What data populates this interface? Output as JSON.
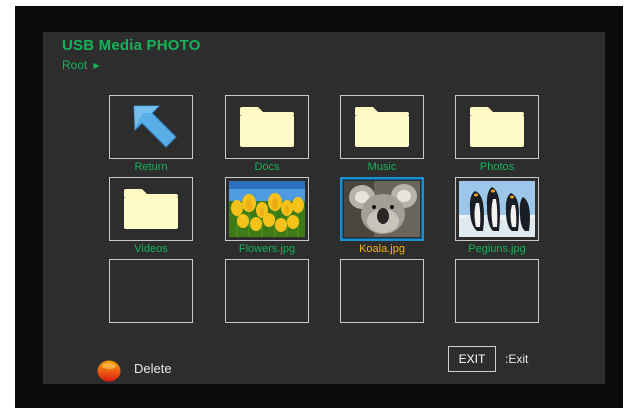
{
  "header": {
    "title": "USB Media  PHOTO",
    "breadcrumb": "Root"
  },
  "grid": {
    "items": [
      {
        "label": "Return",
        "icon": "return-arrow-icon",
        "kind": "return"
      },
      {
        "label": "Docs",
        "icon": "folder-icon",
        "kind": "folder"
      },
      {
        "label": "Music",
        "icon": "folder-icon",
        "kind": "folder"
      },
      {
        "label": "Photos",
        "icon": "folder-icon",
        "kind": "folder"
      },
      {
        "label": "Videos",
        "icon": "folder-icon",
        "kind": "folder"
      },
      {
        "label": "Flowers.jpg",
        "icon": "flowers-thumbnail",
        "kind": "image"
      },
      {
        "label": "Koala.jpg",
        "icon": "koala-thumbnail",
        "kind": "image",
        "selected": true
      },
      {
        "label": "Pegiuns.jpg",
        "icon": "penguins-thumbnail",
        "kind": "image"
      }
    ]
  },
  "footer": {
    "delete_label": "Delete",
    "exit_key": "EXIT",
    "exit_label": ":Exit"
  },
  "colors": {
    "accent_green": "#16b25a",
    "selected_caption": "#f3b21a",
    "selection_border": "#1b8fd0",
    "panel_bg": "#2d2d2d",
    "frame_bg": "#0a0a0a",
    "delete_key_top": "#f0a000",
    "delete_key_bottom": "#d81e10"
  }
}
